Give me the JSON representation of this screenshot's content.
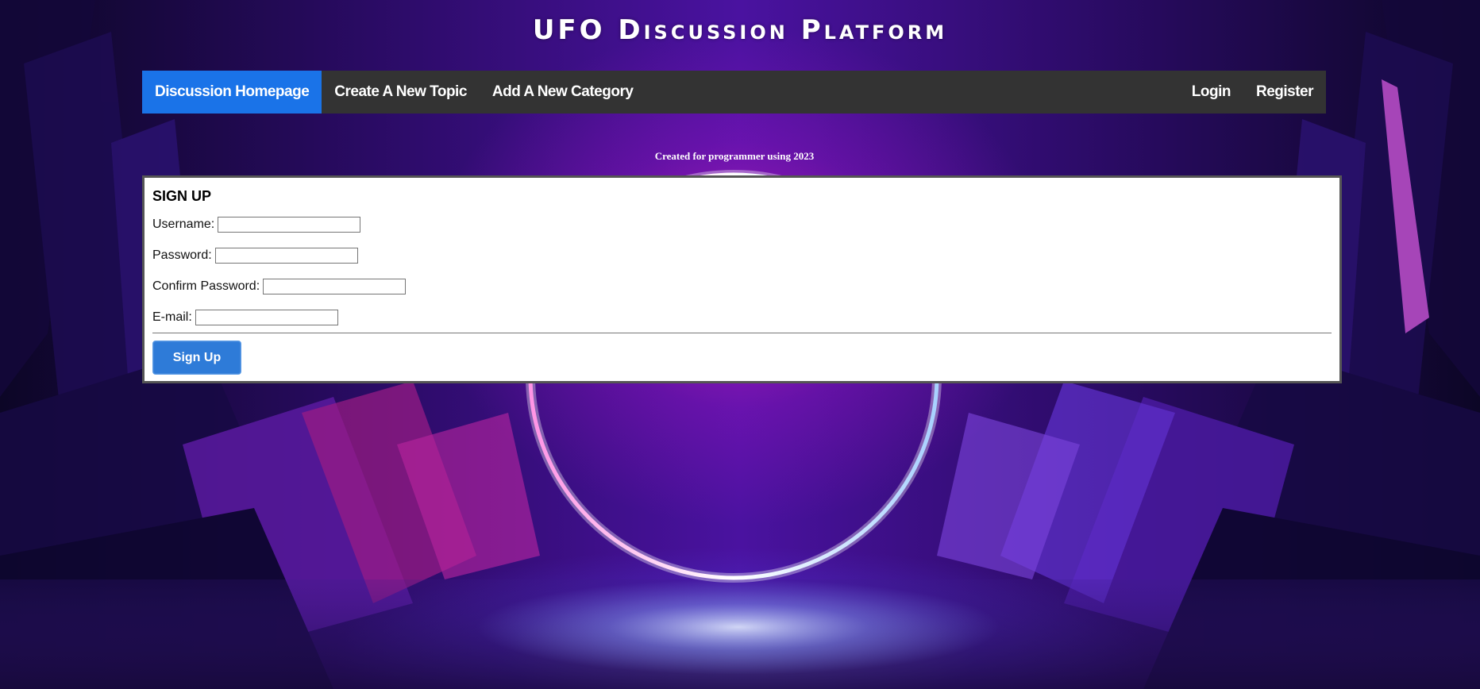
{
  "header": {
    "title": "UFO Discussion Platform"
  },
  "nav": {
    "left_items": [
      {
        "label": "Discussion Homepage",
        "active": true
      },
      {
        "label": "Create A New Topic",
        "active": false
      },
      {
        "label": "Add A New Category",
        "active": false
      }
    ],
    "right_items": [
      {
        "label": "Login"
      },
      {
        "label": "Register"
      }
    ]
  },
  "credit": "Created for programmer using 2023",
  "signup": {
    "heading": "SIGN UP",
    "fields": {
      "username": {
        "label": "Username:",
        "value": ""
      },
      "password": {
        "label": "Password:",
        "value": ""
      },
      "confirm_password": {
        "label": "Confirm Password:",
        "value": ""
      },
      "email": {
        "label": "E-mail:",
        "value": ""
      }
    },
    "button_label": "Sign Up"
  },
  "colors": {
    "nav_background": "#333333",
    "nav_active": "#1a73e8",
    "button": "#2e7bd8"
  },
  "background": {
    "scene": "neon ring portal in crystal cave",
    "icon": "background-image"
  }
}
